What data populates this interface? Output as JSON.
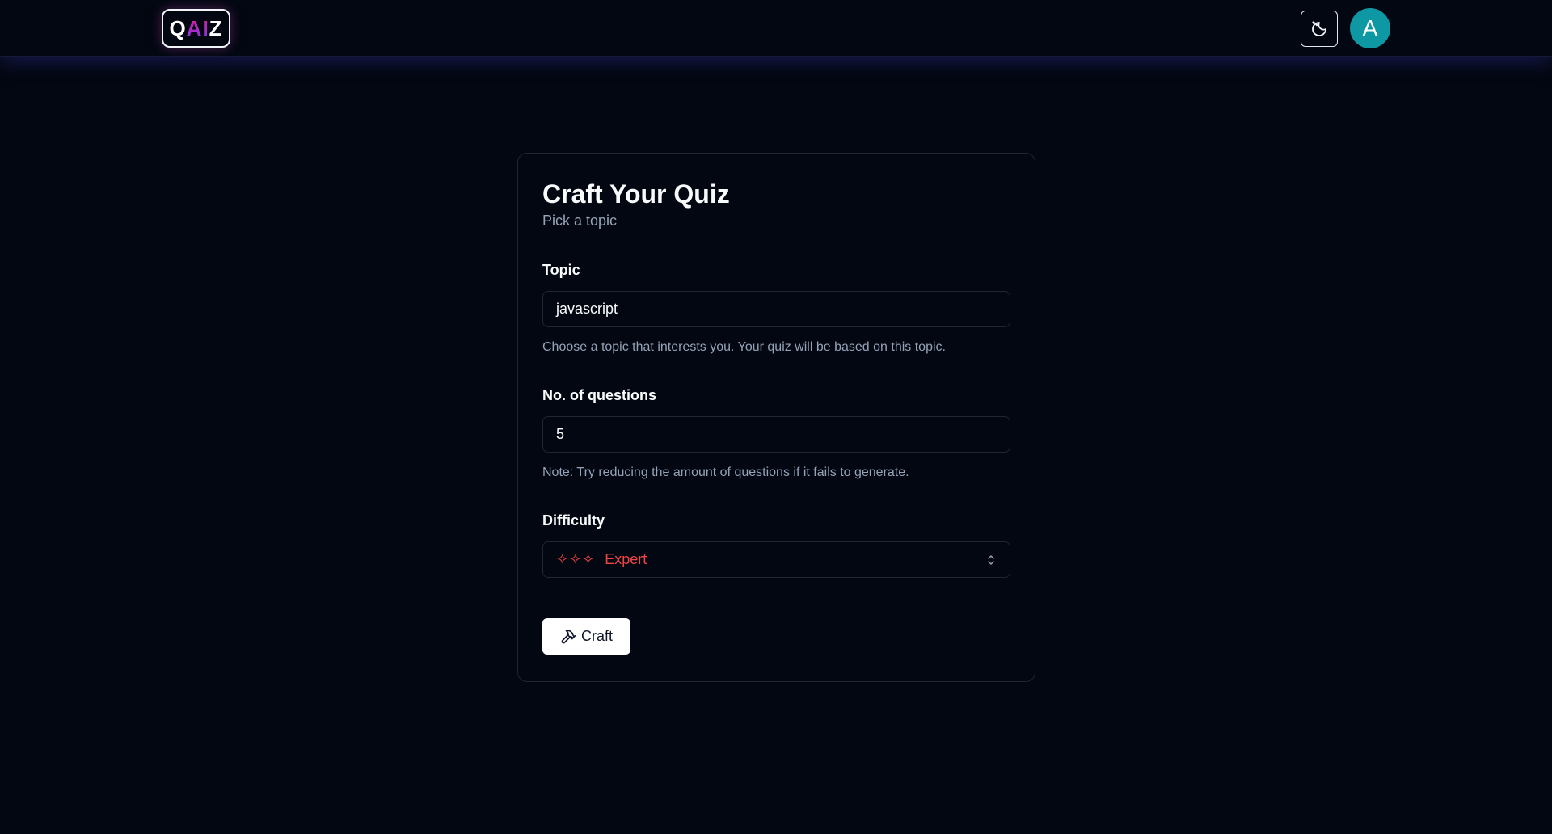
{
  "header": {
    "logo": {
      "q": "Q",
      "ai": "AI",
      "z": "Z"
    },
    "theme_toggle_icon": "moon-sparkle-icon",
    "avatar_initial": "A",
    "avatar_color": "#0e98a4"
  },
  "form": {
    "title": "Craft Your Quiz",
    "subtitle": "Pick a topic",
    "topic": {
      "label": "Topic",
      "value": "javascript",
      "hint": "Choose a topic that interests you. Your quiz will be based on this topic."
    },
    "questions": {
      "label": "No. of questions",
      "value": "5",
      "hint": "Note: Try reducing the amount of questions if it fails to generate."
    },
    "difficulty": {
      "label": "Difficulty",
      "stars": "✧✧✧",
      "value": "Expert",
      "color": "#ef4444"
    },
    "submit_label": "Craft",
    "submit_icon": "hammer-icon"
  }
}
